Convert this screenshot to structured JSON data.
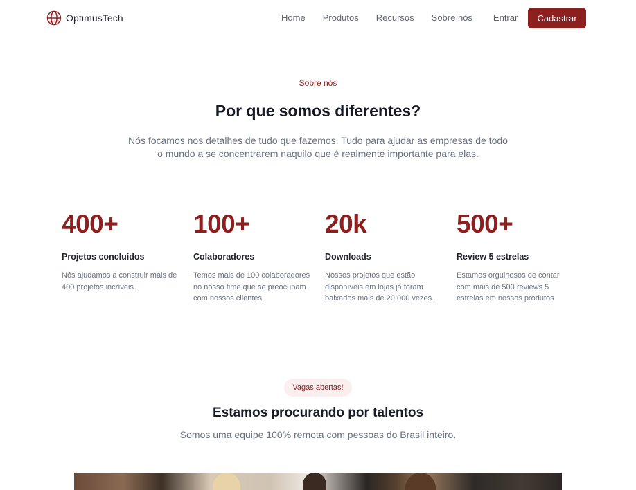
{
  "brand": {
    "name": "OptimusTech",
    "logo_icon": "globe-icon",
    "accent": "#8e1f1f"
  },
  "nav": {
    "links": [
      "Home",
      "Produtos",
      "Recursos",
      "Sobre nós",
      "Entrar"
    ],
    "cta": "Cadastrar"
  },
  "about": {
    "eyebrow": "Sobre nós",
    "title": "Por que somos diferentes?",
    "lead": "Nós focamos nos detalhes de tudo que fazemos. Tudo para ajudar as empresas de todo o mundo a se concentrarem naquilo que é realmente importante para elas."
  },
  "stats": [
    {
      "value": "400+",
      "title": "Projetos concluídos",
      "desc": "Nós ajudamos a construir mais de 400 projetos incríveis."
    },
    {
      "value": "100+",
      "title": "Colaboradores",
      "desc": "Temos mais de 100 colaboradores no nosso time que se preocupam com nossos clientes."
    },
    {
      "value": "20k",
      "title": "Downloads",
      "desc": "Nossos projetos que estão disponíveis em lojas já foram baixados mais de 20.000 vezes."
    },
    {
      "value": "500+",
      "title": "Review 5 estrelas",
      "desc": "Estamos orgulhosos de contar com mais de 500 reviews 5 estrelas em nossos produtos"
    }
  ],
  "careers": {
    "badge": "Vagas abertas!",
    "title": "Estamos procurando por talentos",
    "subtitle": "Somos uma equipe 100% remota com pessoas do Brasil inteiro."
  }
}
